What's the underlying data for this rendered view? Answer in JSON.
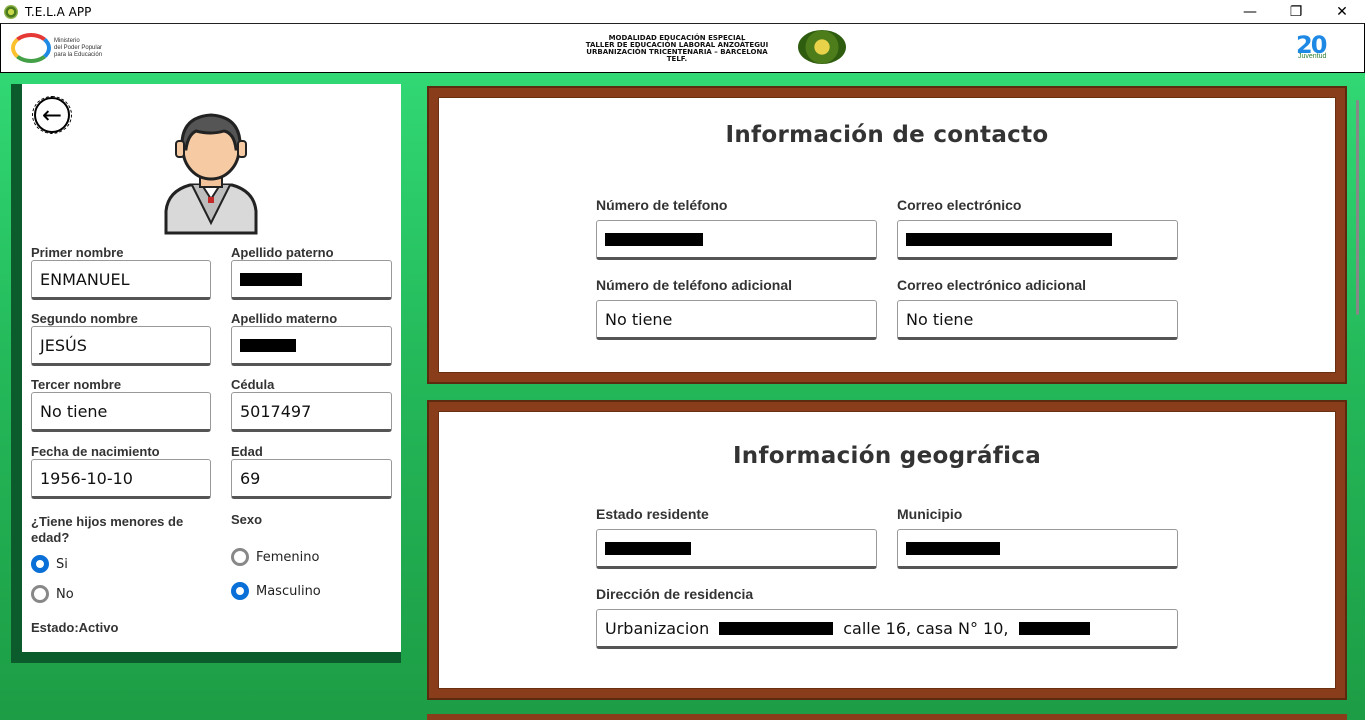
{
  "window": {
    "title": "T.E.L.A APP",
    "controls": [
      "—",
      "❐",
      "✕"
    ]
  },
  "header": {
    "left_logo_text": [
      "Ministerio",
      "del Poder Popular",
      "para la Educación"
    ],
    "center_lines": [
      "MODALIDAD EDUCACIÓN ESPECIAL",
      "TALLER DE EDUCACIÓN LABORAL ANZOÁTEGUI",
      "URBANIZACIÓN TRICENTENARIA – BARCELONA",
      "TELF."
    ],
    "right_logo_big": "20",
    "right_logo_small": "Juventud"
  },
  "profile": {
    "back_icon": "arrow-left-icon",
    "avatar_icon": "student-avatar-icon",
    "fields": {
      "primer_nombre": {
        "label": "Primer nombre",
        "value": "ENMANUEL"
      },
      "apellido_paterno": {
        "label": "Apellido paterno",
        "value": ""
      },
      "segundo_nombre": {
        "label": "Segundo nombre",
        "value": "JESÚS"
      },
      "apellido_materno": {
        "label": "Apellido materno",
        "value": ""
      },
      "tercer_nombre": {
        "label": "Tercer nombre",
        "value": "No tiene"
      },
      "cedula": {
        "label": "Cédula",
        "value": "5017497"
      },
      "fecha_nacimiento": {
        "label": "Fecha de nacimiento",
        "value": "1956-10-10"
      },
      "edad": {
        "label": "Edad",
        "value": "69"
      }
    },
    "hijos": {
      "label": "¿Tiene hijos menores de edad?",
      "options": [
        {
          "label": "Si",
          "selected": true
        },
        {
          "label": "No",
          "selected": false
        }
      ]
    },
    "sexo": {
      "label": "Sexo",
      "options": [
        {
          "label": "Femenino",
          "selected": false
        },
        {
          "label": "Masculino",
          "selected": true
        }
      ]
    },
    "estado": "Estado:Activo"
  },
  "contacto": {
    "title": "Información de contacto",
    "telefono": {
      "label": "Número de teléfono",
      "value": ""
    },
    "correo": {
      "label": "Correo electrónico",
      "value": ""
    },
    "telefono_adicional": {
      "label": "Número de teléfono adicional",
      "value": "No tiene"
    },
    "correo_adicional": {
      "label": "Correo electrónico adicional",
      "value": "No tiene"
    }
  },
  "geografica": {
    "title": "Información geográfica",
    "estado": {
      "label": "Estado residente",
      "value": ""
    },
    "municipio": {
      "label": "Municipio",
      "value": ""
    },
    "direccion": {
      "label": "Dirección de residencia",
      "part1": "Urbanizacion",
      "part2": "calle 16, casa N° 10,"
    }
  },
  "colors": {
    "green_bg": "#24b95a",
    "panel_border": "#8a3d1a",
    "radio_on": "#0a6fd6"
  }
}
